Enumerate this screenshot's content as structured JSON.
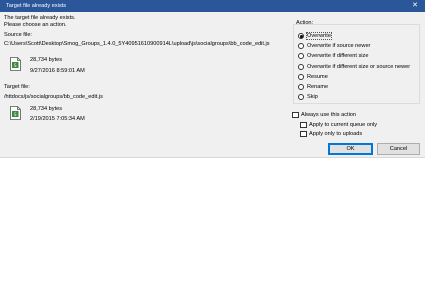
{
  "window": {
    "title": "Target file already exists",
    "close_glyph": "✕"
  },
  "message": {
    "line1": "The target file already exists.",
    "line2": "Please choose an action."
  },
  "source": {
    "heading": "Source file:",
    "path": "C:\\Users\\Scott\\Desktop\\Smog_Groups_1.4.0_5Y40951610900914L\\upload\\js\\socialgroups\\bb_code_edit.js",
    "size": "28,734 bytes",
    "date": "9/27/2016 8:59:01 AM",
    "icon": "js-file-icon"
  },
  "target": {
    "heading": "Target file:",
    "path": "/httdocs/js/socialgroups/bb_code_edit.js",
    "size": "28,734 bytes",
    "date": "2/19/2015 7:05:34 AM",
    "icon": "js-file-icon"
  },
  "action": {
    "heading": "Action:",
    "options": [
      {
        "label": "Overwrite",
        "selected": true
      },
      {
        "label": "Overwrite if source newer",
        "selected": false
      },
      {
        "label": "Overwrite if different size",
        "selected": false
      },
      {
        "label": "Overwrite if different size or source newer",
        "selected": false
      },
      {
        "label": "Resume",
        "selected": false
      },
      {
        "label": "Rename",
        "selected": false
      },
      {
        "label": "Skip",
        "selected": false
      }
    ]
  },
  "options": {
    "always": {
      "label": "Always use this action",
      "checked": false
    },
    "current_queue": {
      "label": "Apply to current queue only",
      "checked": false
    },
    "uploads_only": {
      "label": "Apply only to uploads",
      "checked": false
    }
  },
  "buttons": {
    "ok": "OK",
    "cancel": "Cancel"
  },
  "colors": {
    "titlebar": "#2b579a",
    "dialog_bg": "#f0f0f0",
    "default_button_border": "#0078d7"
  }
}
